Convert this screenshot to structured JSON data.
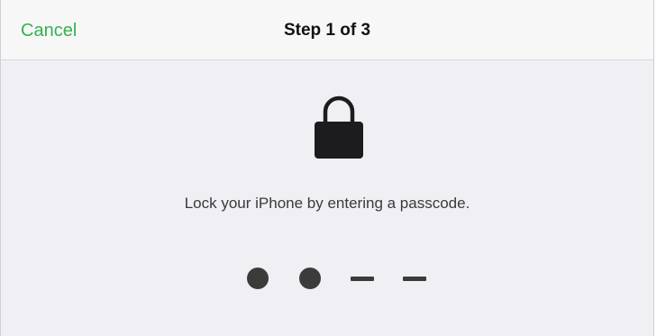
{
  "navbar": {
    "cancel_label": "Cancel",
    "title": "Step 1 of 3"
  },
  "icon": "lock-icon",
  "message": "Lock your iPhone by entering a passcode.",
  "passcode": {
    "length": 4,
    "entered": 2
  },
  "colors": {
    "accent": "#34b24f",
    "background": "#efeff4",
    "navbar": "#f7f7f8",
    "glyph": "#3b3b3b"
  }
}
